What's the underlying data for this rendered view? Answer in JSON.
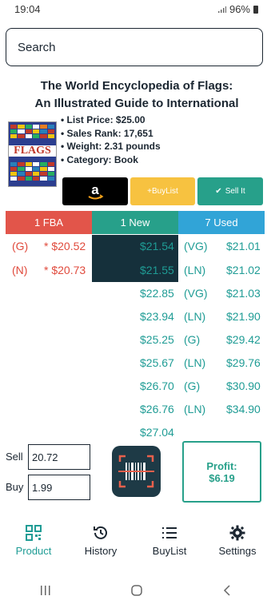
{
  "status": {
    "time": "19:04",
    "battery": "96%"
  },
  "search": {
    "placeholder": "Search"
  },
  "product": {
    "title": "The World Encyclopedia of Flags: An Illustrated Guide to International",
    "cover_word": "FLAGS",
    "details": [
      "List Price: $25.00",
      "Sales Rank: 17,651",
      "Weight: 2.31 pounds",
      "Category: Book"
    ]
  },
  "actions": {
    "amazon_label": "a",
    "buylist_label": "+BuyList",
    "sellit_label": "Sell It",
    "sellit_icon": "check-icon"
  },
  "offers": {
    "headers": {
      "fba": "1 FBA",
      "new": "1 New",
      "used": "7 Used"
    },
    "fba": [
      {
        "cond": "(G)",
        "price": "* $20.52"
      },
      {
        "cond": "(N)",
        "price": "* $20.73"
      }
    ],
    "new": [
      "$21.54",
      "$21.55",
      "$22.85",
      "$23.94",
      "$25.25",
      "$25.67",
      "$26.70",
      "$26.76",
      "$27.04"
    ],
    "used": [
      {
        "cond": "(VG)",
        "price": "$21.01"
      },
      {
        "cond": "(LN)",
        "price": "$21.02"
      },
      {
        "cond": "(VG)",
        "price": "$21.03"
      },
      {
        "cond": "(LN)",
        "price": "$21.90"
      },
      {
        "cond": "(G)",
        "price": "$29.42"
      },
      {
        "cond": "(LN)",
        "price": "$29.76"
      },
      {
        "cond": "(G)",
        "price": "$30.90"
      },
      {
        "cond": "(LN)",
        "price": "$34.90"
      }
    ]
  },
  "pricing": {
    "sell_label": "Sell",
    "sell_value": "20.72",
    "buy_label": "Buy",
    "buy_value": "1.99"
  },
  "profit": {
    "label": "Profit:",
    "value": "$6.19"
  },
  "nav": [
    {
      "label": "Product",
      "icon": "qr-code-icon"
    },
    {
      "label": "History",
      "icon": "history-icon"
    },
    {
      "label": "BuyList",
      "icon": "list-icon"
    },
    {
      "label": "Settings",
      "icon": "gear-icon"
    }
  ],
  "colors": {
    "teal": "#27a08a",
    "red": "#e2554a",
    "blue": "#31a4d7",
    "yellow": "#f7c240",
    "navy": "#15303b"
  }
}
